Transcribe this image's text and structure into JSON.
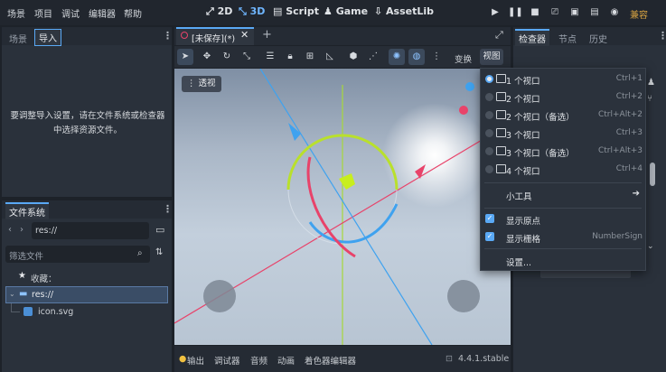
{
  "menubar": {
    "menus": [
      "场景",
      "项目",
      "调试",
      "编辑器",
      "帮助"
    ],
    "workspaces": [
      "2D",
      "3D",
      "Script",
      "Game",
      "AssetLib"
    ],
    "active_workspace": "3D",
    "renderer": "兼容"
  },
  "left_top": {
    "tabs": [
      "场景",
      "导入"
    ],
    "selected_tab": "导入",
    "message": "要调整导入设置，请在文件系统或检查器中选择资源文件。"
  },
  "filesystem": {
    "tab": "文件系统",
    "path": "res://",
    "filter_placeholder": "筛选文件",
    "favorites": "收藏：",
    "root": "res://",
    "file": "icon.svg"
  },
  "editor": {
    "scene_tab": "[未保存](*)",
    "toolbar_right": [
      "变换",
      "视图"
    ],
    "viewport_label": "透视"
  },
  "view_menu": {
    "items": [
      {
        "label": "1 个视口",
        "shortcut": "Ctrl+1",
        "radio_on": true
      },
      {
        "label": "2 个视口",
        "shortcut": "Ctrl+2",
        "radio_on": false
      },
      {
        "label": "2 个视口（备选）",
        "shortcut": "Ctrl+Alt+2",
        "radio_on": false
      },
      {
        "label": "3 个视口",
        "shortcut": "Ctrl+3",
        "radio_on": false
      },
      {
        "label": "3 个视口（备选）",
        "shortcut": "Ctrl+Alt+3",
        "radio_on": false
      },
      {
        "label": "4 个视口",
        "shortcut": "Ctrl+4",
        "radio_on": false
      }
    ],
    "gizmos": "小工具",
    "show_origin": "显示原点",
    "show_grid": "显示栅格",
    "grid_shortcut": "NumberSign",
    "settings": "设置..."
  },
  "inspector": {
    "tabs": [
      "检查器",
      "节点",
      "历史"
    ],
    "selected_tab": "检查器"
  },
  "bottom": {
    "tabs": [
      "输出",
      "调试器",
      "音频",
      "动画",
      "着色器编辑器"
    ],
    "version": "4.4.1.stable"
  },
  "colors": {
    "accent": "#5aa9f5",
    "x_axis": "#e8436a",
    "y_axis": "#a7d83a",
    "z_axis": "#3fa2ef",
    "viewport_sky": "#b7c5d6"
  }
}
